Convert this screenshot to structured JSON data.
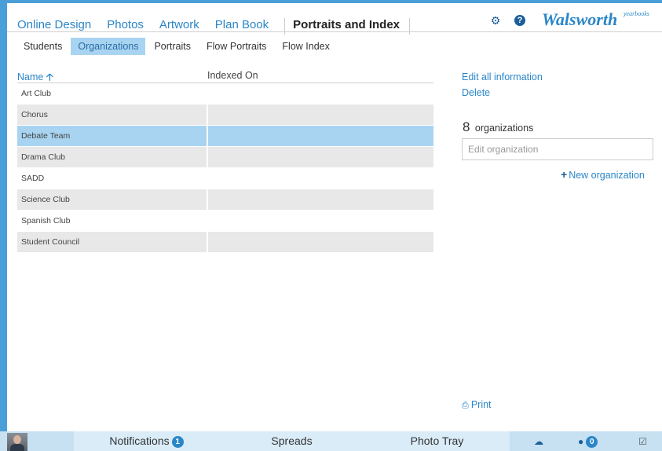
{
  "topnav": {
    "tabs": [
      {
        "label": "Online Design"
      },
      {
        "label": "Photos"
      },
      {
        "label": "Artwork"
      },
      {
        "label": "Plan Book"
      },
      {
        "label": "Portraits and Index"
      }
    ],
    "brand": "Walsworth",
    "brand_sub": "yearbooks"
  },
  "subnav": {
    "tabs": [
      {
        "label": "Students"
      },
      {
        "label": "Organizations"
      },
      {
        "label": "Portraits"
      },
      {
        "label": "Flow Portraits"
      },
      {
        "label": "Flow Index"
      }
    ]
  },
  "table": {
    "col_name": "Name",
    "col_indexed": "Indexed On",
    "rows": [
      {
        "name": "Art Club"
      },
      {
        "name": "Chorus"
      },
      {
        "name": "Debate Team"
      },
      {
        "name": "Drama Club"
      },
      {
        "name": "SADD"
      },
      {
        "name": "Science Club"
      },
      {
        "name": "Spanish Club"
      },
      {
        "name": "Student Council"
      }
    ]
  },
  "panel": {
    "edit_all": "Edit all information",
    "delete": "Delete",
    "count": "8",
    "count_label": "organizations",
    "edit_placeholder": "Edit organization",
    "new_org": "New organization",
    "print": "Print"
  },
  "bottom": {
    "notifications": "Notifications",
    "notifications_count": "1",
    "spreads": "Spreads",
    "photo_tray": "Photo Tray",
    "chat_count": "0"
  },
  "colors": {
    "accent": "#2a86c8",
    "selected_row": "#a8d4f1",
    "frame": "#4a9fd8"
  }
}
